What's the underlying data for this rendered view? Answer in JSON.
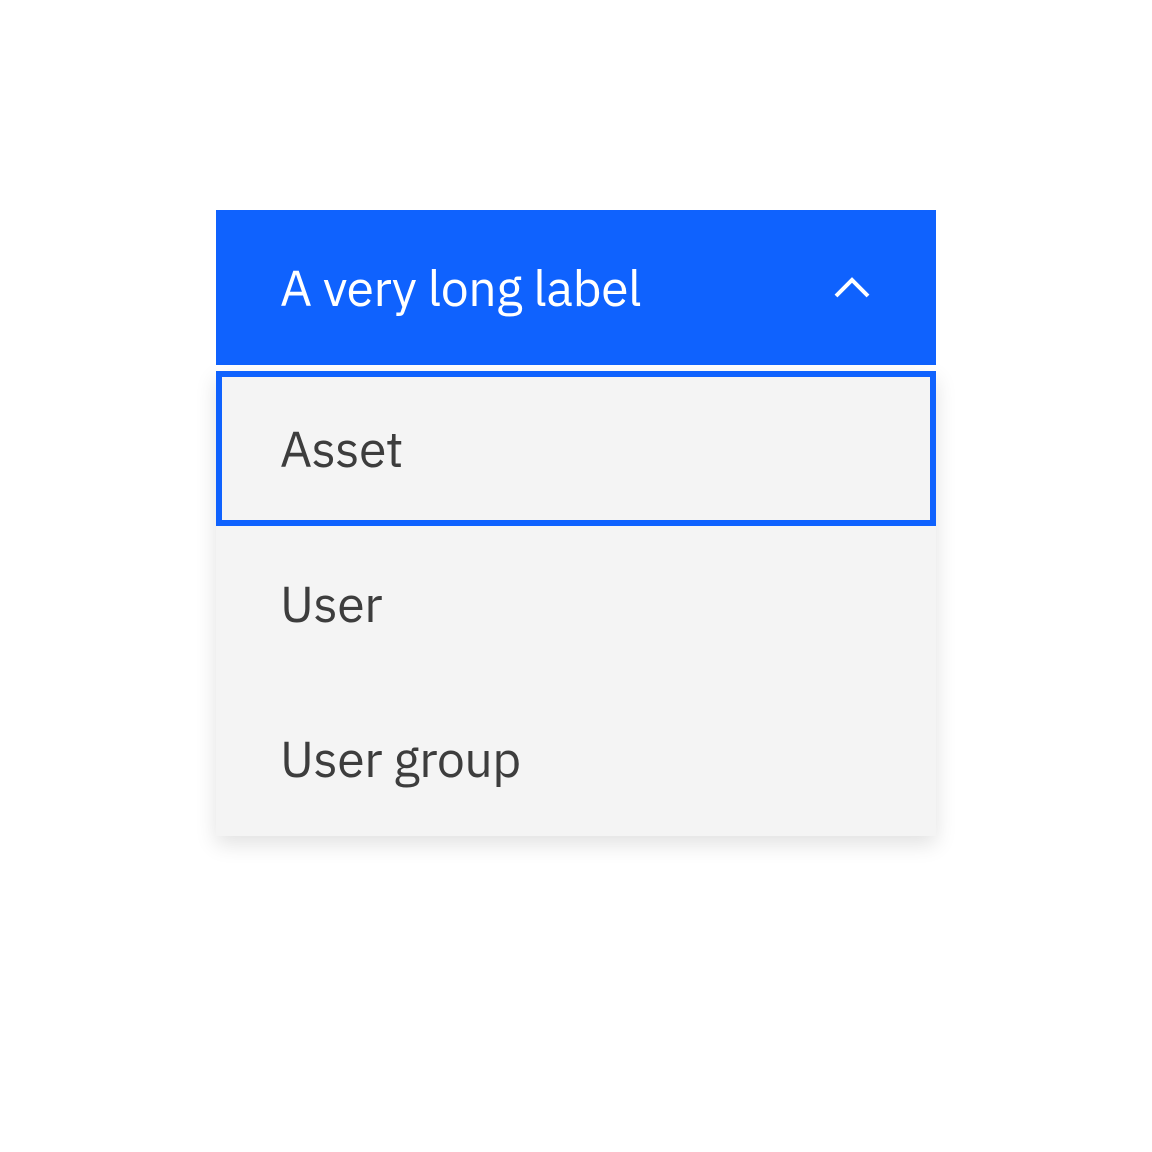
{
  "dropdown": {
    "label": "A very long label",
    "items": [
      {
        "label": "Asset"
      },
      {
        "label": "User"
      },
      {
        "label": "User group"
      }
    ]
  }
}
